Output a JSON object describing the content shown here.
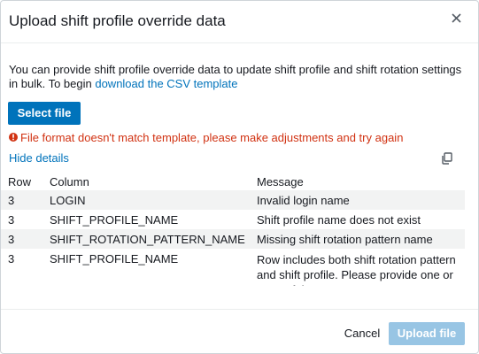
{
  "dialog": {
    "title": "Upload shift profile override data",
    "close_icon": "close-icon"
  },
  "intro": {
    "text": "You can provide shift profile override data to update shift profile and shift rotation settings in bulk. To begin ",
    "link": "download the CSV template"
  },
  "select_file_label": "Select file",
  "error": {
    "icon": "error-icon",
    "text": "File format doesn't match template, please make adjustments and try again",
    "color": "#d13212"
  },
  "hide_details_label": "Hide details",
  "copy_icon": "copy-icon",
  "table": {
    "headers": [
      "Row",
      "Column",
      "Message"
    ],
    "rows": [
      {
        "row": "3",
        "column": "LOGIN",
        "message": "Invalid login name"
      },
      {
        "row": "3",
        "column": "SHIFT_PROFILE_NAME",
        "message": "Shift profile name does not exist"
      },
      {
        "row": "3",
        "column": "SHIFT_ROTATION_PATTERN_NAME",
        "message": "Missing shift rotation pattern name"
      },
      {
        "row": "3",
        "column": "SHIFT_PROFILE_NAME",
        "message": "Row includes both shift rotation pattern and shift profile. Please provide one or none of them."
      }
    ]
  },
  "footer": {
    "cancel_label": "Cancel",
    "upload_label": "Upload file"
  },
  "colors": {
    "accent": "#0073bb",
    "disabled_primary": "#98c5e4",
    "error": "#d13212"
  }
}
